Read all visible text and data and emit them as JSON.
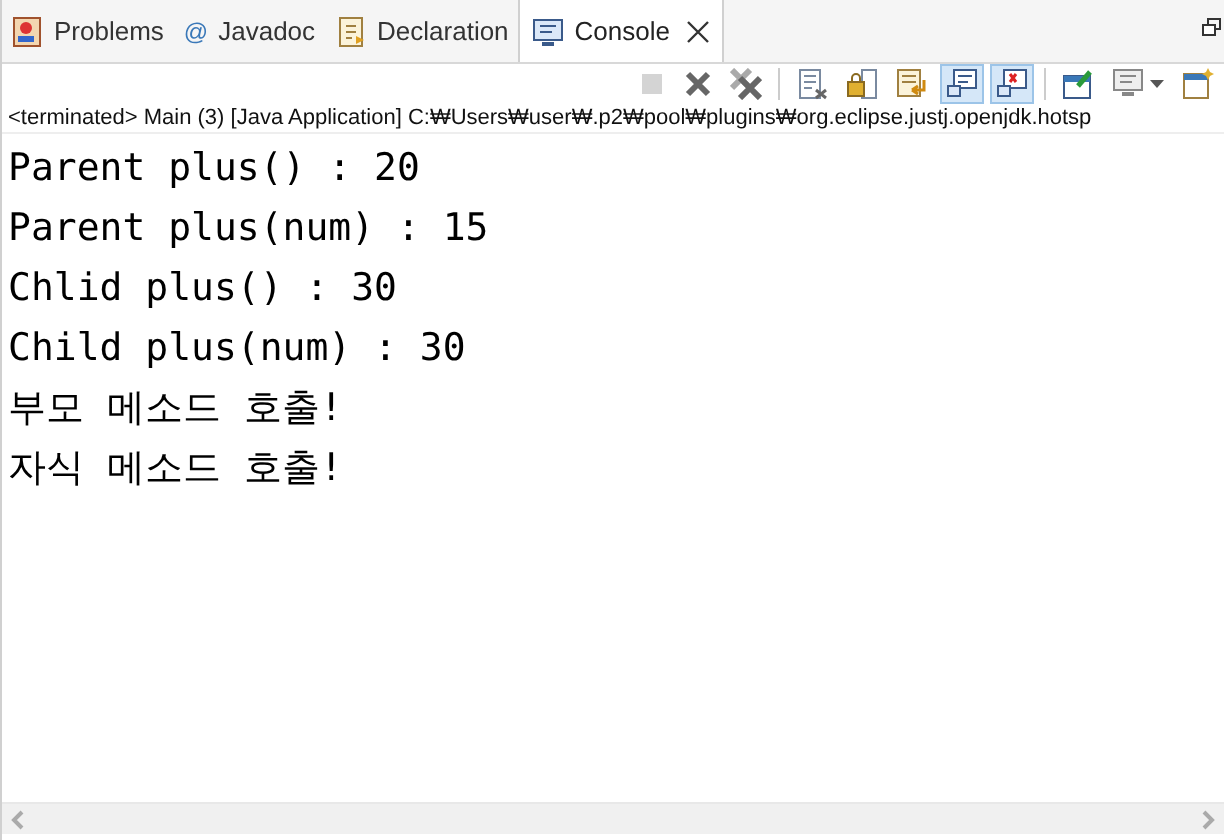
{
  "tabs": [
    {
      "label": "Problems",
      "kind": "problems",
      "selected": false
    },
    {
      "label": "Javadoc",
      "kind": "javadoc",
      "icon_char": "@",
      "selected": false
    },
    {
      "label": "Declaration",
      "kind": "declaration",
      "selected": false
    },
    {
      "label": "Console",
      "kind": "console",
      "selected": true,
      "closable": true
    }
  ],
  "toolbar": [
    {
      "kind": "stop",
      "disabled": true,
      "selected": false
    },
    {
      "kind": "remove",
      "disabled": false,
      "selected": false
    },
    {
      "kind": "remove-all",
      "disabled": false,
      "selected": false
    },
    {
      "kind": "sep"
    },
    {
      "kind": "clear",
      "disabled": false,
      "selected": false
    },
    {
      "kind": "lock",
      "disabled": false,
      "selected": false
    },
    {
      "kind": "wrap",
      "disabled": false,
      "selected": false
    },
    {
      "kind": "show-out",
      "disabled": false,
      "selected": true
    },
    {
      "kind": "show-err",
      "disabled": false,
      "selected": true
    },
    {
      "kind": "sep"
    },
    {
      "kind": "pin",
      "disabled": false,
      "selected": false
    },
    {
      "kind": "display",
      "disabled": false,
      "selected": false,
      "dropdown": true
    },
    {
      "kind": "new",
      "disabled": false,
      "selected": false
    }
  ],
  "process_label": "<terminated> Main (3) [Java Application] C:₩Users₩user₩.p2₩pool₩plugins₩org.eclipse.justj.openjdk.hotsp",
  "console_lines": [
    "Parent plus() : 20",
    "Parent plus(num) : 15",
    "Chlid plus() : 30",
    "Child plus(num) : 30",
    "부모 메소드 호출!",
    "자식 메소드 호출!"
  ]
}
